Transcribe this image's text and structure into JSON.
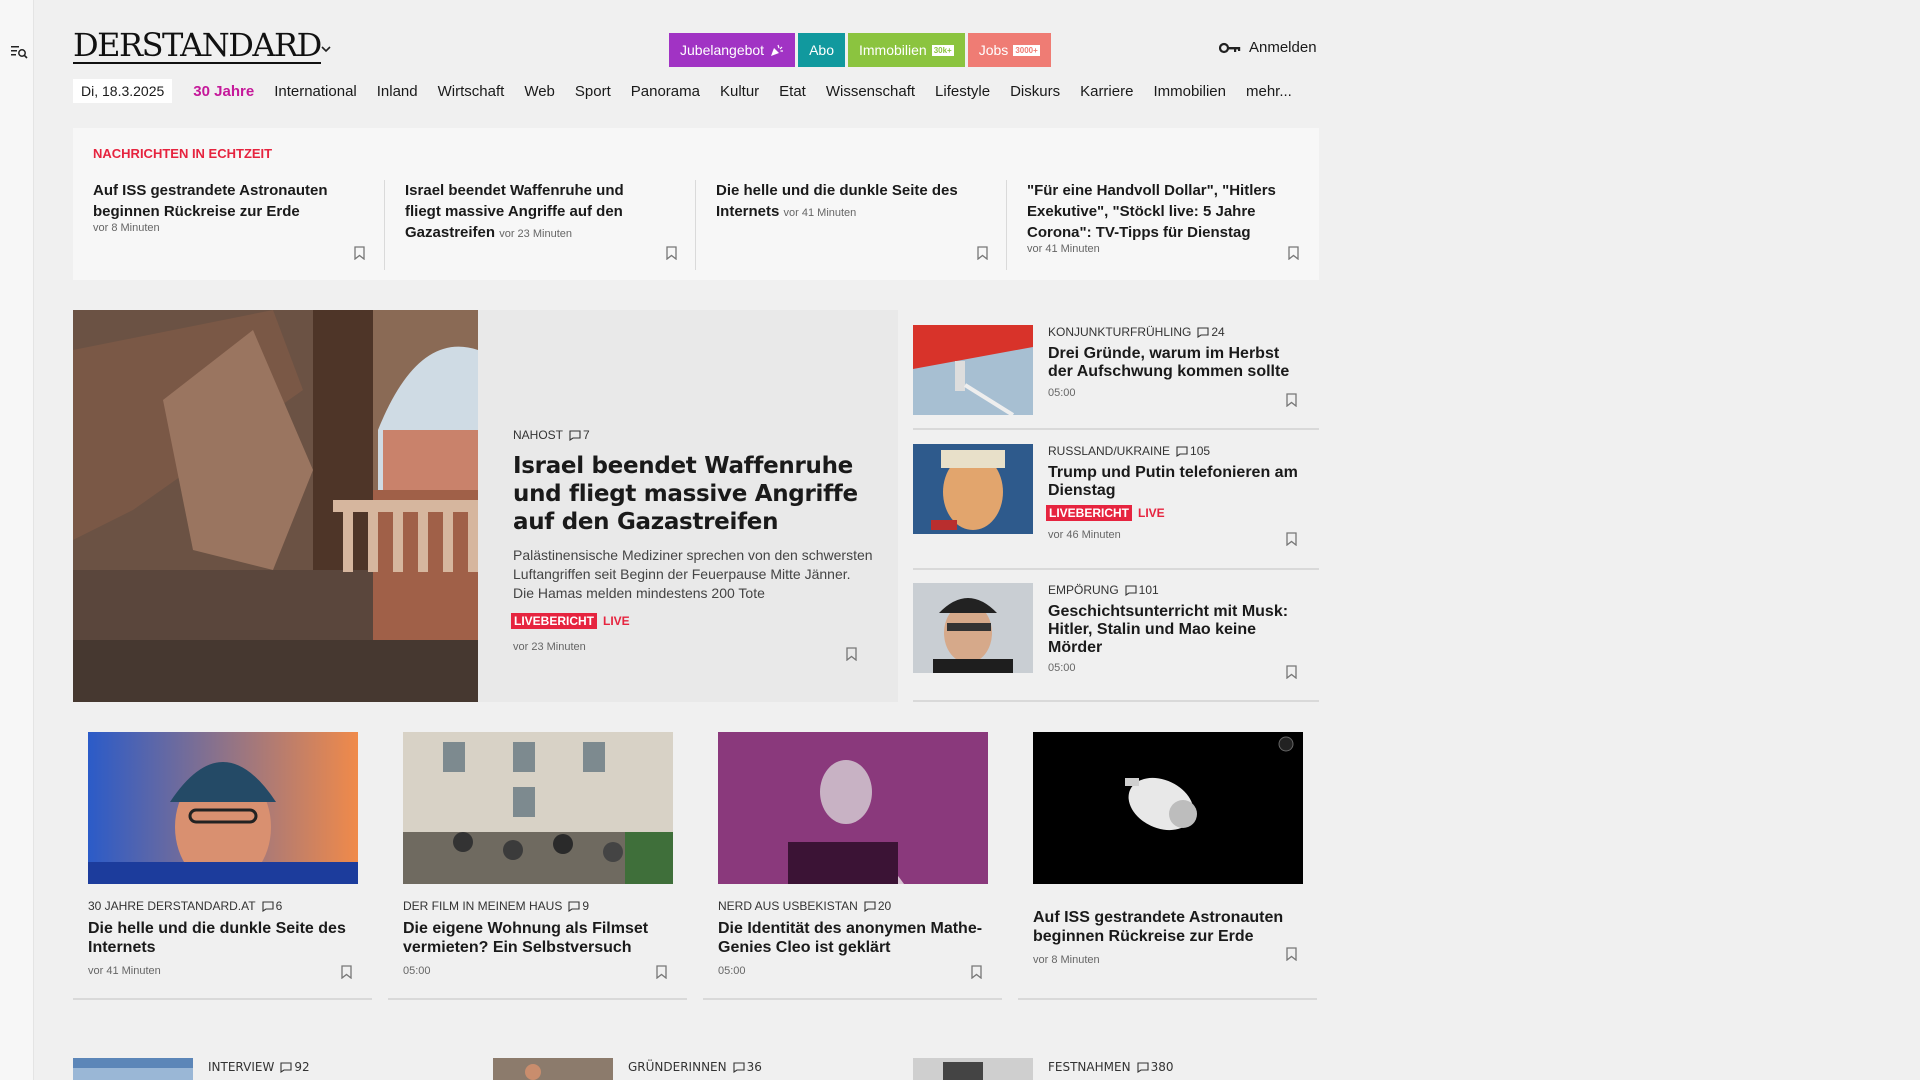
{
  "brand": {
    "logo": "DERSTANDARD"
  },
  "promos": [
    {
      "label": "Jubelangebot",
      "tag": ""
    },
    {
      "label": "Abo",
      "tag": ""
    },
    {
      "label": "Immobilien",
      "tag": "30k+"
    },
    {
      "label": "Jobs",
      "tag": "3000+"
    }
  ],
  "login": {
    "label": "Anmelden"
  },
  "nav": {
    "date": "Di, 18.3.2025",
    "items": [
      "30 Jahre",
      "International",
      "Inland",
      "Wirtschaft",
      "Web",
      "Sport",
      "Panorama",
      "Kultur",
      "Etat",
      "Wissenschaft",
      "Lifestyle",
      "Diskurs",
      "Karriere",
      "Immobilien",
      "mehr..."
    ]
  },
  "ticker": {
    "label": "NACHRICHTEN IN ECHTZEIT",
    "items": [
      {
        "title": "Auf ISS gestrandete Astronauten beginnen Rückreise zur Erde",
        "time": "vor 8 Minuten"
      },
      {
        "title": "Israel beendet Waffenruhe und fliegt massive Angriffe auf den Gazastreifen",
        "time": "vor 23 Minuten"
      },
      {
        "title": "Die helle und die dunkle Seite des Internets",
        "time": "vor 41 Minuten"
      },
      {
        "title": "\"Für eine Handvoll Dollar\", \"Hitlers Exekutive\", \"Stöckl live: 5 Jahre Corona\": TV-Tipps für Dienstag",
        "time": "vor 41 Minuten"
      }
    ]
  },
  "lead": {
    "kicker": "NAHOST",
    "comments": "7",
    "title": "Israel beendet Waffenruhe und fliegt massive Angriffe auf den Gazastreifen",
    "teaser": "Palästinensische Mediziner sprechen von den schwersten Luftangriffen seit Beginn der Feuerpause Mitte Jänner. Die Hamas melden mindestens 200 Tote",
    "live_badge": "LIVEBERICHT",
    "live_text": "LIVE",
    "time": "vor 23 Minuten"
  },
  "side": [
    {
      "kicker": "KONJUNKTURFRÜHLING",
      "comments": "24",
      "title": "Drei Gründe, warum im Herbst der Aufschwung kommen sollte",
      "time": "05:00"
    },
    {
      "kicker": "RUSSLAND/UKRAINE",
      "comments": "105",
      "title": "Trump und Putin telefonieren am Dienstag",
      "live_badge": "LIVEBERICHT",
      "live_text": "LIVE",
      "time": "vor 46 Minuten"
    },
    {
      "kicker": "EMPÖRUNG",
      "comments": "101",
      "title": "Geschichtsunterricht mit Musk: Hitler, Stalin und Mao keine Mörder",
      "time": "05:00"
    }
  ],
  "cards": [
    {
      "kicker": "30 JAHRE DERSTANDARD.AT",
      "comments": "6",
      "title": "Die helle und die dunkle Seite des Internets",
      "time": "vor 41 Minuten"
    },
    {
      "kicker": "DER FILM IN MEINEM HAUS",
      "comments": "9",
      "title": "Die eigene Wohnung als Filmset vermieten? Ein Selbstversuch",
      "time": "05:00"
    },
    {
      "kicker": "NERD AUS USBEKISTAN",
      "comments": "20",
      "title": "Die Identität des anonymen Mathe-Genies Cleo ist geklärt",
      "time": "05:00"
    },
    {
      "kicker": "",
      "comments": "",
      "title": "Auf ISS gestrandete Astronauten beginnen Rückreise zur Erde",
      "time": "vor 8 Minuten"
    }
  ],
  "bottom": [
    {
      "kicker": "INTERVIEW",
      "comments": "92"
    },
    {
      "kicker": "GRÜNDERINNEN",
      "comments": "36"
    },
    {
      "kicker": "FESTNAHMEN",
      "comments": "380"
    }
  ],
  "colors": {
    "accent_live": "#e6243f",
    "thirty_years": "#c5199a",
    "jubel": "#a133c4",
    "abo": "#11999e",
    "immo": "#8bc43f",
    "jobs": "#ef7c74"
  }
}
